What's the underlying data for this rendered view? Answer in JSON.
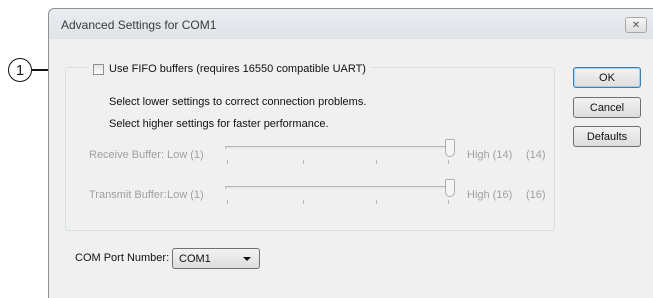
{
  "callout": {
    "number": "1"
  },
  "dialog": {
    "title": "Advanced Settings for COM1",
    "close_icon": "close-icon",
    "close_glyph": "✕"
  },
  "fifo": {
    "label": "Use FIFO buffers (requires 16550 compatible UART)",
    "checked": false
  },
  "hints": {
    "lower": "Select lower settings to correct connection problems.",
    "higher": "Select higher settings for faster performance."
  },
  "receive": {
    "label": "Receive Buffer:",
    "low": "Low (1)",
    "high": "High (14)",
    "value": "(14)",
    "level": 1.0
  },
  "transmit": {
    "label": "Transmit Buffer:",
    "low": "Low (1)",
    "high": "High (16)",
    "value": "(16)",
    "level": 1.0
  },
  "buttons": {
    "ok": "OK",
    "cancel": "Cancel",
    "defaults": "Defaults"
  },
  "com_port": {
    "label": "COM Port Number:",
    "selected": "COM1"
  },
  "colors": {
    "disabled_text": "#a0a0a0",
    "dialog_bg": "#f0f0f0",
    "focus_border": "#3c7fb1"
  }
}
